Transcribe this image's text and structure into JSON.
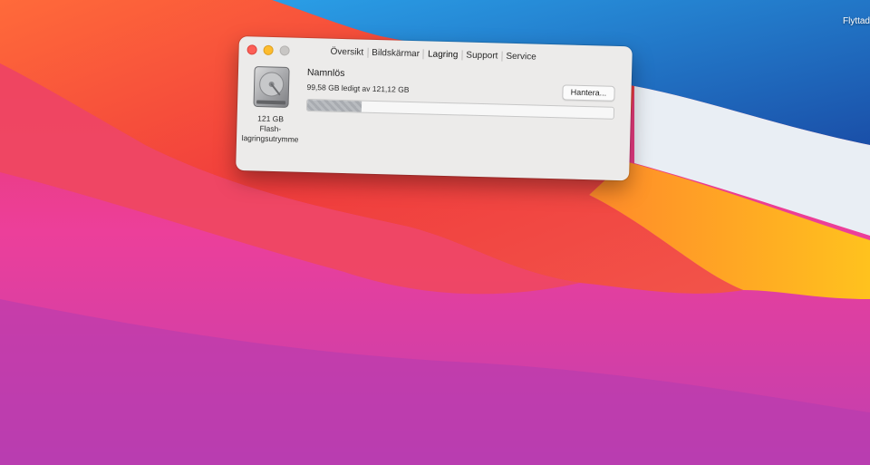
{
  "desktop": {
    "label": "Flyttad"
  },
  "window": {
    "tabs": [
      {
        "label": "Översikt",
        "active": false
      },
      {
        "label": "Bildskärmar",
        "active": false
      },
      {
        "label": "Lagring",
        "active": true
      },
      {
        "label": "Support",
        "active": false
      },
      {
        "label": "Service",
        "active": false
      }
    ]
  },
  "storage": {
    "disk_icon": "hard-drive-icon",
    "caption_lines": [
      "121 GB",
      "Flash-",
      "lagringsutrymme"
    ],
    "volume_name": "Namnlös",
    "free_text": "99,58 GB ledigt av 121,12 GB",
    "free_gb": 99.58,
    "total_gb": 121.12,
    "manage_label": "Hantera..."
  },
  "colors": {
    "close": "#fc5f57",
    "minimize": "#fdbc2e",
    "zoom_disabled": "#c8c6c4"
  }
}
